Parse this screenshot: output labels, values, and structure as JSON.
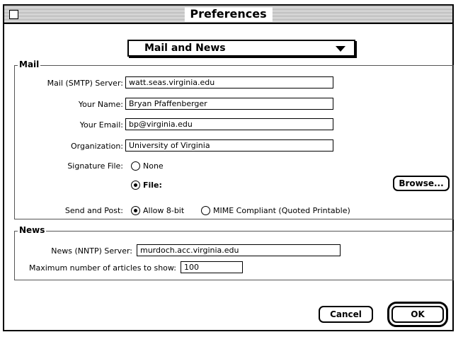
{
  "window": {
    "title": "Preferences"
  },
  "category_popup": {
    "selected": "Mail and News"
  },
  "mail": {
    "group_title": "Mail",
    "smtp_label": "Mail (SMTP) Server:",
    "smtp_value": "watt.seas.virginia.edu",
    "name_label": "Your Name:",
    "name_value": "Bryan Pfaffenberger",
    "email_label": "Your Email:",
    "email_value": "bp@virginia.edu",
    "org_label": "Organization:",
    "org_value": "University of Virginia",
    "signature_label": "Signature File:",
    "signature_none": "None",
    "signature_file": "File:",
    "browse_button": "Browse...",
    "send_post_label": "Send and Post:",
    "allow_8bit": "Allow 8-bit",
    "mime_compliant": "MIME Compliant (Quoted Printable)"
  },
  "news": {
    "group_title": "News",
    "nntp_label": "News (NNTP) Server:",
    "nntp_value": "murdoch.acc.virginia.edu",
    "max_articles_label": "Maximum number of articles to show:",
    "max_articles_value": "100"
  },
  "buttons": {
    "cancel": "Cancel",
    "ok": "OK"
  }
}
